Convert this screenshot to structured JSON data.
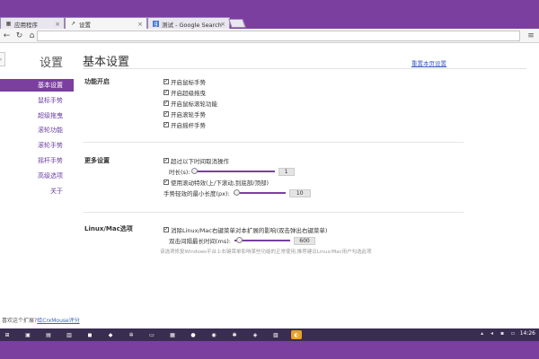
{
  "tabs": [
    {
      "label": "应用程序",
      "favicon": "apps-icon",
      "active": false
    },
    {
      "label": "设置",
      "favicon": "mouse-gesture-icon",
      "active": true
    },
    {
      "label": "测试 - Google Search",
      "favicon": "google-icon",
      "active": false
    }
  ],
  "sidebar": {
    "title": "设置",
    "items": [
      {
        "label": "基本设置",
        "active": true
      },
      {
        "label": "鼠标手势",
        "active": false
      },
      {
        "label": "超级拖曳",
        "active": false
      },
      {
        "label": "滚轮功能",
        "active": false
      },
      {
        "label": "滚轮手势",
        "active": false
      },
      {
        "label": "摇杆手势",
        "active": false
      },
      {
        "label": "高级选项",
        "active": false
      },
      {
        "label": "关于",
        "active": false
      }
    ],
    "footer_prefix": "喜欢这个扩展?",
    "footer_link": "给CrxMouse评分"
  },
  "main": {
    "title": "基本设置",
    "reset_link": "重置本页设置",
    "section_features": {
      "label": "功能开启",
      "options": [
        {
          "label": "开启鼠标手势",
          "checked": true
        },
        {
          "label": "开启超级拖曳",
          "checked": true
        },
        {
          "label": "开启鼠标滚轮功能",
          "checked": true
        },
        {
          "label": "开启滚轮手势",
          "checked": true
        },
        {
          "label": "开启摇杆手势",
          "checked": true
        }
      ]
    },
    "section_more": {
      "label": "更多设置",
      "timeout_check": "超过以下时间取消操作",
      "duration_label": "时长(s):",
      "duration_value": "1",
      "duration_fraction": 0.0,
      "smooth_scroll_check": "使用滚动特效(上/下滚动,到底部/顶部)",
      "min_length_label": "手势轻效的最小长度(px):",
      "min_length_value": "10",
      "min_length_fraction": 0.06
    },
    "section_linux": {
      "label": "Linux/Mac选项",
      "context_menu_check": "消除Linux/Mac右键菜单对本扩展的影响(双击弹出右键菜单)",
      "double_click_label": "双击间隔最长时间(ms):",
      "double_click_value": "600",
      "double_click_fraction": 0.08,
      "hint": "该选项修复Windows平台上右键菜单影响某些功能的正常使用,推荐建议Linux/Mac用户勾选此项"
    }
  },
  "taskbar": {
    "clock": "14:26"
  },
  "colors": {
    "accent": "#7b3fa0",
    "link": "#3a5ec0"
  }
}
